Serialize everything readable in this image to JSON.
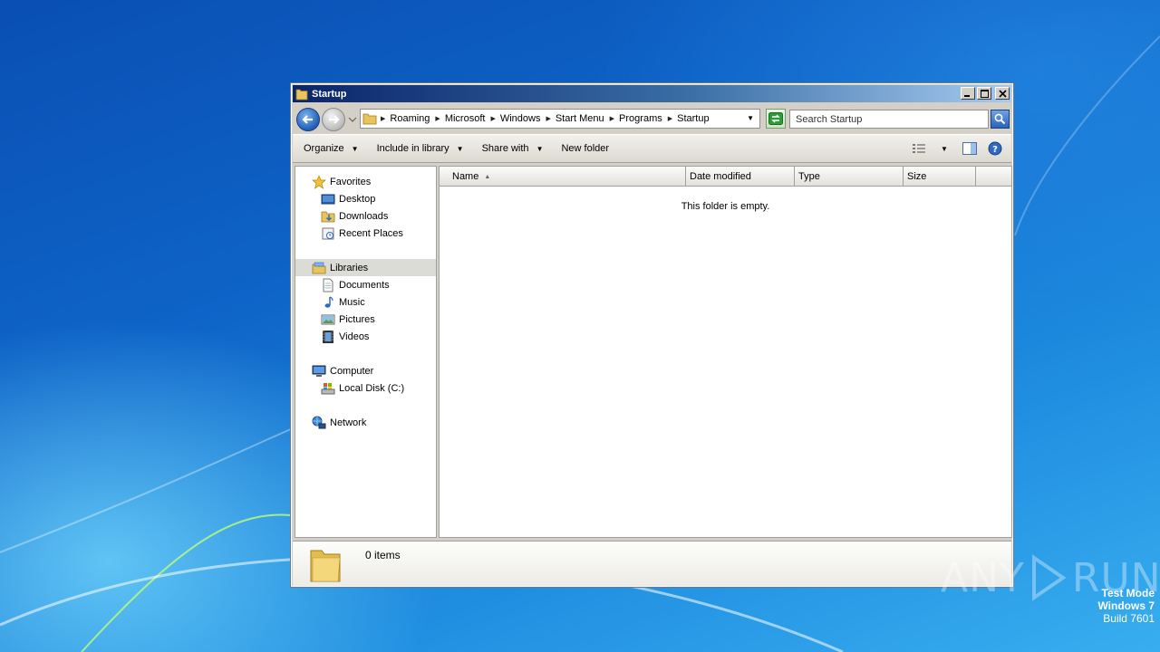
{
  "window": {
    "title": "Startup"
  },
  "address": {
    "breadcrumbs": [
      "Roaming",
      "Microsoft",
      "Windows",
      "Start Menu",
      "Programs",
      "Startup"
    ],
    "search_placeholder": "Search Startup"
  },
  "toolbar": {
    "organize": "Organize",
    "include_in_library": "Include in library",
    "share_with": "Share with",
    "new_folder": "New folder"
  },
  "navigation": {
    "favorites": "Favorites",
    "desktop": "Desktop",
    "downloads": "Downloads",
    "recent_places": "Recent Places",
    "libraries": "Libraries",
    "documents": "Documents",
    "music": "Music",
    "pictures": "Pictures",
    "videos": "Videos",
    "computer": "Computer",
    "local_disk": "Local Disk (C:)",
    "network": "Network"
  },
  "columns": {
    "name": "Name",
    "date_modified": "Date modified",
    "type": "Type",
    "size": "Size"
  },
  "content": {
    "empty_message": "This folder is empty."
  },
  "details": {
    "item_count": "0 items"
  },
  "desktop": {
    "watermark_left": "ANY",
    "watermark_right": "RUN",
    "test_mode": "Test Mode",
    "os_name": "Windows 7",
    "build": "Build 7601"
  },
  "colors": {
    "titlebar_start": "#0a246a",
    "titlebar_end": "#a6caf0",
    "selected_nav": "#dcdcd6"
  }
}
